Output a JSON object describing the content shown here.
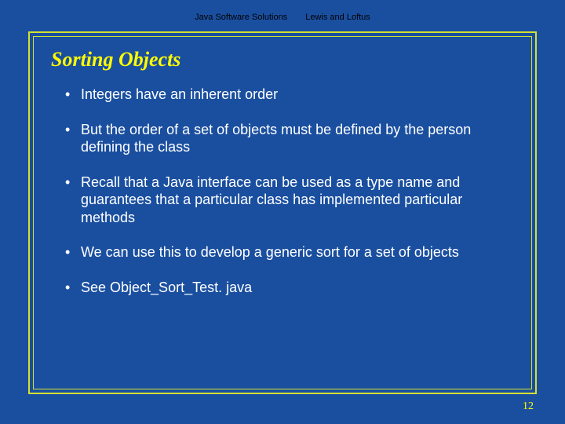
{
  "header": {
    "left": "Java Software Solutions",
    "right": "Lewis and Loftus"
  },
  "title": "Sorting Objects",
  "bullets": [
    "Integers have an inherent order",
    "But the order of a set of objects must be defined by the person defining the class",
    "Recall that a Java interface can be used as a type name and guarantees that a particular class has implemented particular methods",
    "We can use this to develop a generic sort for a set of objects",
    "See Object_Sort_Test. java"
  ],
  "pageNumber": "12"
}
